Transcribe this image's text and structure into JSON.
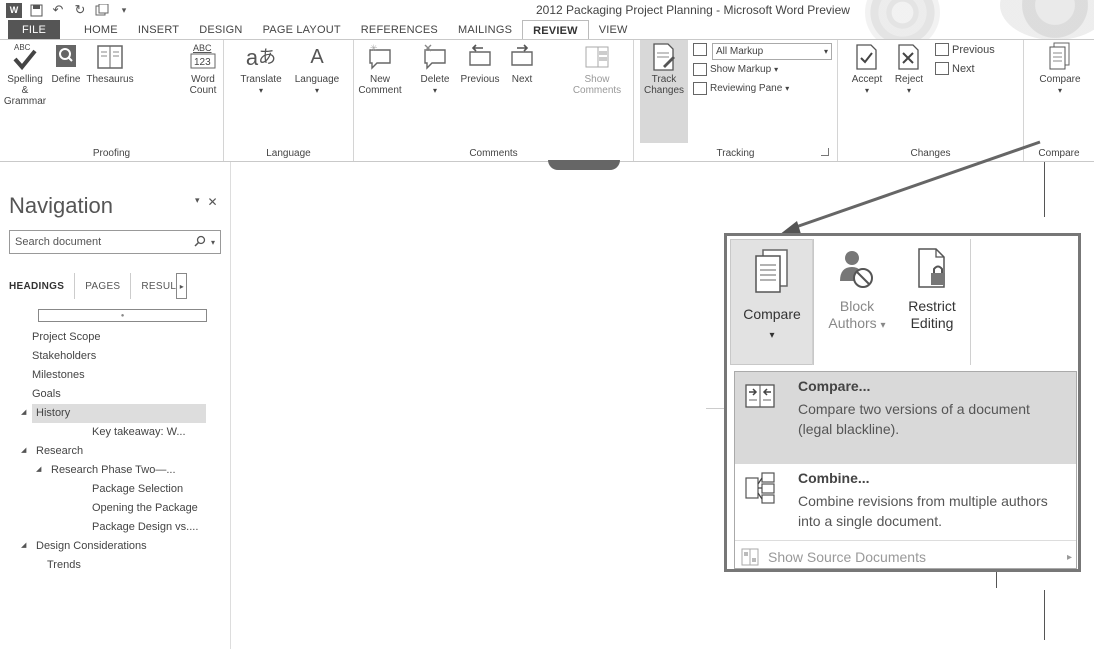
{
  "window": {
    "title": "2012 Packaging Project Planning - Microsoft Word Preview",
    "app_badge": "W"
  },
  "ribbon_tabs": [
    "FILE",
    "HOME",
    "INSERT",
    "DESIGN",
    "PAGE LAYOUT",
    "REFERENCES",
    "MAILINGS",
    "REVIEW",
    "VIEW"
  ],
  "ribbon": {
    "proofing": {
      "label": "Proofing",
      "spelling": "Spelling &\nGrammar",
      "define": "Define",
      "thesaurus": "Thesaurus",
      "word_count": "Word\nCount",
      "abc_text": "ABC",
      "count_digits": "123"
    },
    "language": {
      "label": "Language",
      "translate": "Translate",
      "language": "Language"
    },
    "comments": {
      "label": "Comments",
      "new": "New\nComment",
      "delete": "Delete",
      "previous": "Previous",
      "next": "Next",
      "show": "Show\nComments"
    },
    "tracking": {
      "label": "Tracking",
      "track": "Track\nChanges",
      "markup_select": "All Markup",
      "show_markup": "Show Markup",
      "reviewing_pane": "Reviewing Pane"
    },
    "changes": {
      "label": "Changes",
      "accept": "Accept",
      "reject": "Reject",
      "previous": "Previous",
      "next": "Next"
    },
    "compare": {
      "label": "Compare",
      "compare": "Compare"
    }
  },
  "navigation": {
    "title": "Navigation",
    "search_placeholder": "Search document",
    "tabs": [
      "HEADINGS",
      "PAGES",
      "RESUL"
    ],
    "headings": [
      {
        "text": "Project Scope",
        "level": 1,
        "expanded": null,
        "selected": false
      },
      {
        "text": "Stakeholders",
        "level": 1,
        "expanded": null,
        "selected": false
      },
      {
        "text": "Milestones",
        "level": 1,
        "expanded": null,
        "selected": false
      },
      {
        "text": "Goals",
        "level": 1,
        "expanded": null,
        "selected": false
      },
      {
        "text": "History",
        "level": 1,
        "expanded": true,
        "selected": true
      },
      {
        "text": "Key takeaway: W...",
        "level": 3,
        "expanded": null,
        "selected": false
      },
      {
        "text": "Research",
        "level": 1,
        "expanded": true,
        "selected": false
      },
      {
        "text": "Research Phase Two—...",
        "level": 2,
        "expanded": true,
        "selected": false
      },
      {
        "text": "Package Selection",
        "level": 3,
        "expanded": null,
        "selected": false
      },
      {
        "text": "Opening the Package",
        "level": 3,
        "expanded": null,
        "selected": false
      },
      {
        "text": "Package Design vs....",
        "level": 3,
        "expanded": null,
        "selected": false
      },
      {
        "text": "Design Considerations",
        "level": 1,
        "expanded": true,
        "selected": false
      },
      {
        "text": "Trends",
        "level": 2,
        "expanded": null,
        "selected": false
      }
    ]
  },
  "callout": {
    "buttons": {
      "compare": "Compare",
      "block": "Block",
      "authors": "Authors",
      "restrict": "Restrict",
      "editing": "Editing"
    },
    "menu": {
      "compare_title": "Compare...",
      "compare_desc": "Compare two versions of a document (legal blackline).",
      "combine_title": "Combine...",
      "combine_desc": "Combine revisions from multiple authors into a single document.",
      "show_source": "Show Source Documents"
    }
  }
}
